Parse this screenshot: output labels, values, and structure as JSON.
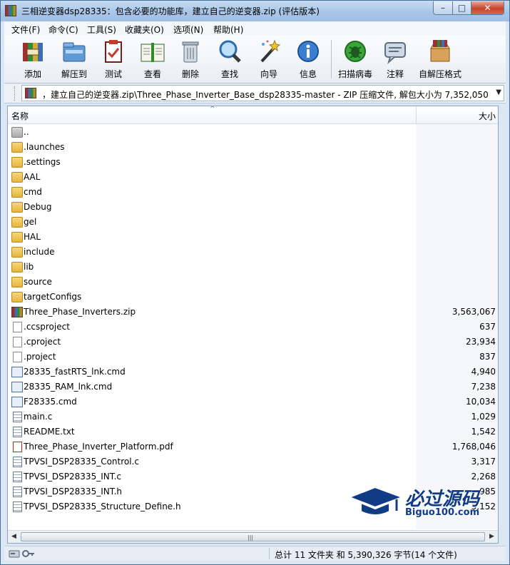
{
  "window": {
    "title": "三相逆变器dsp28335：包含必要的功能库，建立自己的逆变器.zip (评估版本)",
    "controls": {
      "minimize": "–",
      "maximize": "□",
      "close": "✕"
    }
  },
  "menu": [
    "文件(F)",
    "命令(C)",
    "工具(S)",
    "收藏夹(O)",
    "选项(N)",
    "帮助(H)"
  ],
  "toolbar": [
    {
      "label": "添加",
      "icon": "add-archive-icon"
    },
    {
      "label": "解压到",
      "icon": "extract-to-icon"
    },
    {
      "label": "测试",
      "icon": "test-icon"
    },
    {
      "label": "查看",
      "icon": "view-icon"
    },
    {
      "label": "删除",
      "icon": "delete-icon"
    },
    {
      "label": "查找",
      "icon": "find-icon"
    },
    {
      "label": "向导",
      "icon": "wizard-icon"
    },
    {
      "label": "信息",
      "icon": "info-icon"
    },
    {
      "label": "扫描病毒",
      "icon": "virus-scan-icon"
    },
    {
      "label": "注释",
      "icon": "comment-icon"
    },
    {
      "label": "自解压格式",
      "icon": "sfx-icon"
    }
  ],
  "address": {
    "text": "，建立自己的逆变器.zip\\Three_Phase_Inverter_Base_dsp28335-master - ZIP 压缩文件, 解包大小为 7,352,050 字节",
    "dropdown": "▼"
  },
  "list": {
    "columns": {
      "name": "名称",
      "size": "大小"
    },
    "sort_indicator": "^",
    "items": [
      {
        "name": "..",
        "size": "",
        "type": "up"
      },
      {
        "name": ".launches",
        "size": "",
        "type": "folder"
      },
      {
        "name": ".settings",
        "size": "",
        "type": "folder"
      },
      {
        "name": "AAL",
        "size": "",
        "type": "folder"
      },
      {
        "name": "cmd",
        "size": "",
        "type": "folder"
      },
      {
        "name": "Debug",
        "size": "",
        "type": "folder"
      },
      {
        "name": "gel",
        "size": "",
        "type": "folder"
      },
      {
        "name": "HAL",
        "size": "",
        "type": "folder"
      },
      {
        "name": "include",
        "size": "",
        "type": "folder"
      },
      {
        "name": "lib",
        "size": "",
        "type": "folder"
      },
      {
        "name": "source",
        "size": "",
        "type": "folder"
      },
      {
        "name": "targetConfigs",
        "size": "",
        "type": "folder"
      },
      {
        "name": "Three_Phase_Inverters.zip",
        "size": "3,563,067",
        "type": "zip"
      },
      {
        "name": ".ccsproject",
        "size": "637",
        "type": "file"
      },
      {
        "name": ".cproject",
        "size": "23,934",
        "type": "file"
      },
      {
        "name": ".project",
        "size": "837",
        "type": "file"
      },
      {
        "name": "28335_fastRTS_lnk.cmd",
        "size": "4,940",
        "type": "cmd"
      },
      {
        "name": "28335_RAM_lnk.cmd",
        "size": "7,238",
        "type": "cmd"
      },
      {
        "name": "F28335.cmd",
        "size": "10,034",
        "type": "cmd"
      },
      {
        "name": "main.c",
        "size": "1,029",
        "type": "c"
      },
      {
        "name": "README.txt",
        "size": "1,542",
        "type": "c"
      },
      {
        "name": "Three_Phase_Inverter_Platform.pdf",
        "size": "1,768,046",
        "type": "pdf"
      },
      {
        "name": "TPVSI_DSP28335_Control.c",
        "size": "3,317",
        "type": "c"
      },
      {
        "name": "TPVSI_DSP28335_INT.c",
        "size": "2,268",
        "type": "c"
      },
      {
        "name": "TPVSI_DSP28335_INT.h",
        "size": "985",
        "type": "c"
      },
      {
        "name": "TPVSI_DSP28335_Structure_Define.h",
        "size": "3,152",
        "type": "c"
      }
    ]
  },
  "hscroll": {
    "left": "◀",
    "right": "▶",
    "grip": "|||"
  },
  "watermark": {
    "brand": "必过源码",
    "domain": "Biguo100.com"
  },
  "status": {
    "summary": "总计 11 文件夹 和 5,390,326 字节(14 个文件)"
  }
}
